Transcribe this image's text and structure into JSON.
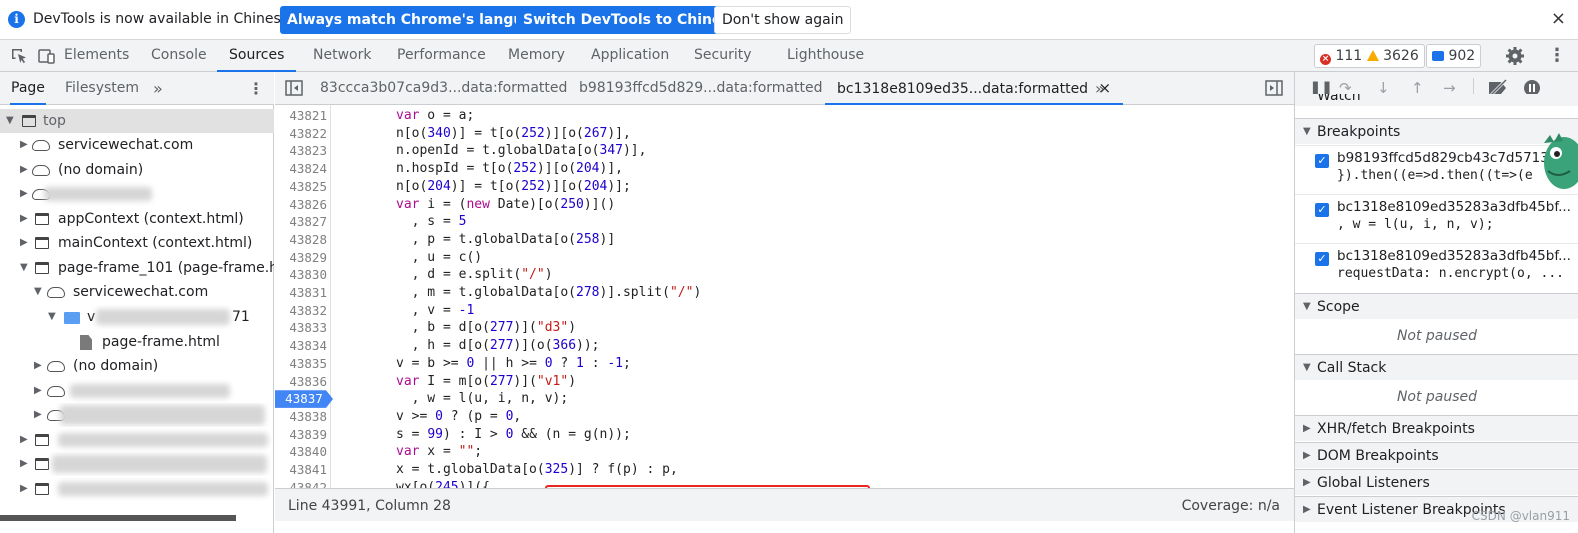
{
  "infobar": {
    "info_icon": "info-icon",
    "message": "DevTools is now available in Chinese!",
    "btn_match": "Always match Chrome's language",
    "btn_switch": "Switch DevTools to Chinese",
    "btn_dismiss": "Don't show again",
    "close_label": "×"
  },
  "main_tabs": {
    "items": [
      "Elements",
      "Console",
      "Sources",
      "Network",
      "Performance",
      "Memory",
      "Application",
      "Security",
      "Lighthouse"
    ],
    "active": "Sources",
    "errors": "111",
    "warnings": "3626",
    "messages": "902"
  },
  "navigator": {
    "tabs": [
      "Page",
      "Filesystem"
    ],
    "more": "»",
    "menu": "⋮",
    "tree": [
      {
        "label": "top"
      },
      {
        "label": "servicewechat.com"
      },
      {
        "label": "(no domain)"
      },
      {
        "label": "appContext (context.html)"
      },
      {
        "label": "mainContext (context.html)"
      },
      {
        "label": "page-frame_101 (page-frame.html"
      },
      {
        "label": "servicewechat.com"
      },
      {
        "label": "v"
      },
      {
        "label": "71"
      },
      {
        "label": "page-frame.html"
      },
      {
        "label": "(no domain)"
      }
    ]
  },
  "editor": {
    "tabs": [
      "83ccca3b07ca9d3...data:formatted",
      "b98193ffcd5d829...data:formatted",
      "bc1318e8109ed35...data:formatted"
    ],
    "active_close": "×",
    "more": "»",
    "breakpoint_line": "43837",
    "lines": [
      {
        "n": "43821",
        "code": "var o = a;"
      },
      {
        "n": "43822",
        "code": "n[o(340)] = t[o(252)][o(267)],"
      },
      {
        "n": "43823",
        "code": "n.openId = t.globalData[o(347)],"
      },
      {
        "n": "43824",
        "code": "n.hospId = t[o(252)][o(204)],"
      },
      {
        "n": "43825",
        "code": "n[o(204)] = t[o(252)][o(204)];"
      },
      {
        "n": "43826",
        "code": "var i = (new Date)[o(250)]()"
      },
      {
        "n": "43827",
        "code": "  , s = 5"
      },
      {
        "n": "43828",
        "code": "  , p = t.globalData[o(258)]"
      },
      {
        "n": "43829",
        "code": "  , u = c()"
      },
      {
        "n": "43830",
        "code": "  , d = e.split(\"/\")"
      },
      {
        "n": "43831",
        "code": "  , m = t.globalData[o(278)].split(\"/\")"
      },
      {
        "n": "43832",
        "code": "  , v = -1"
      },
      {
        "n": "43833",
        "code": "  , b = d[o(277)](\"d3\")"
      },
      {
        "n": "43834",
        "code": "  , h = d[o(277)](o(366));"
      },
      {
        "n": "43835",
        "code": "v = b >= 0 || h >= 0 ? 1 : -1;"
      },
      {
        "n": "43836",
        "code": "var I = m[o(277)](\"v1\")"
      },
      {
        "n": "43837",
        "code": "  , w = l(u, i, n, v);"
      },
      {
        "n": "43838",
        "code": "v >= 0 ? (p = 0,"
      },
      {
        "n": "43839",
        "code": "s = 99) : I > 0 && (n = g(n));"
      },
      {
        "n": "43840",
        "code": "var x = \"\";"
      },
      {
        "n": "43841",
        "code": "x = t.globalData[o(325)] ? f(p) : p,"
      },
      {
        "n": "43842",
        "code": "wx[o(245)]({"
      }
    ],
    "status_position": "Line 43991, Column 28",
    "coverage": "Coverage: n/a"
  },
  "debugger": {
    "watch_label": "Watch",
    "breakpoints_label": "Breakpoints",
    "breakpoints": [
      {
        "file": "b98193ffcd5d829cb43c7d5713",
        "code": "}).then((e=>d.then((t=>(e"
      },
      {
        "file": "bc1318e8109ed35283a3dfb45bf...",
        "code": ", w = l(u, i, n, v);"
      },
      {
        "file": "bc1318e8109ed35283a3dfb45bf...",
        "code": "requestData: n.encrypt(o, ..."
      }
    ],
    "scope_label": "Scope",
    "scope_status": "Not paused",
    "callstack_label": "Call Stack",
    "callstack_status": "Not paused",
    "xhr_label": "XHR/fetch Breakpoints",
    "dom_label": "DOM Breakpoints",
    "global_label": "Global Listeners",
    "event_label": "Event Listener Breakpoints"
  },
  "watermark": "CSDN @vlan911",
  "colors": {
    "accent": "#1a73e8",
    "highlight_box": "#e8281f",
    "error": "#d93025",
    "warning": "#f9ab00"
  }
}
